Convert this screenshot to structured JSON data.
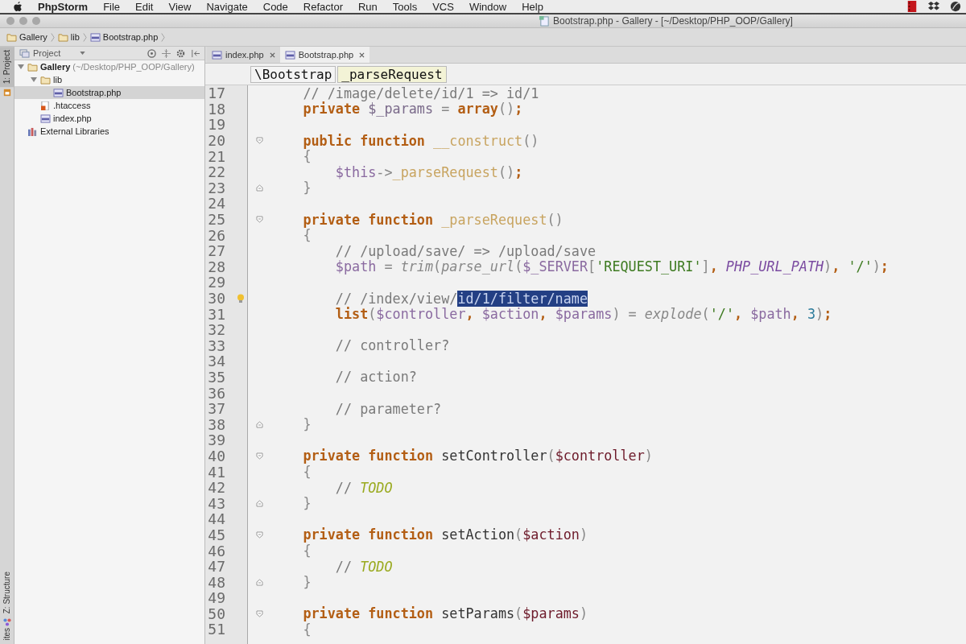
{
  "menu_bar": {
    "app": "PhpStorm",
    "items": [
      "File",
      "Edit",
      "View",
      "Navigate",
      "Code",
      "Refactor",
      "Run",
      "Tools",
      "VCS",
      "Window",
      "Help"
    ]
  },
  "window": {
    "title": "Bootstrap.php - Gallery - [~/Desktop/PHP_OOP/Gallery]"
  },
  "navigation_bar": [
    {
      "label": "Gallery",
      "kind": "folder"
    },
    {
      "label": "lib",
      "kind": "folder"
    },
    {
      "label": "Bootstrap.php",
      "kind": "php"
    }
  ],
  "tool_strip": {
    "top": "1: Project",
    "bottom": "Z: Structure",
    "cut": "ites"
  },
  "project_panel": {
    "title": "Project",
    "tree": [
      {
        "label": "Gallery",
        "hint": "(~/Desktop/PHP_OOP/Gallery)",
        "kind": "folder",
        "expanded": true,
        "selected": false,
        "children": [
          {
            "label": "lib",
            "kind": "folder",
            "expanded": true,
            "selected": false,
            "children": [
              {
                "label": "Bootstrap.php",
                "kind": "php",
                "selected": true
              }
            ]
          },
          {
            "label": ".htaccess",
            "kind": "config",
            "selected": false
          },
          {
            "label": "index.php",
            "kind": "php",
            "selected": false
          }
        ]
      },
      {
        "label": "External Libraries",
        "kind": "library",
        "selected": false
      }
    ]
  },
  "tabs": [
    {
      "label": "index.php",
      "selected": false
    },
    {
      "label": "Bootstrap.php",
      "selected": true
    }
  ],
  "editor_breadcrumb": [
    "\\Bootstrap",
    "_parseRequest"
  ],
  "lines": [
    {
      "number": "17",
      "kind": "code",
      "tokens": [
        {
          "kind": "comment",
          "text": "    // /image/delete/id/1 => id/1"
        }
      ]
    },
    {
      "number": "18",
      "kind": "code",
      "tokens": [
        {
          "kind": "kw",
          "text": "    private "
        },
        {
          "kind": "field",
          "text": "$_params"
        },
        {
          "kind": "punct",
          "text": " = "
        },
        {
          "kind": "kw",
          "text": "array"
        },
        {
          "kind": "punct",
          "text": "()"
        },
        {
          "kind": "kw",
          "text": ";"
        }
      ]
    },
    {
      "number": "19",
      "kind": "code"
    },
    {
      "number": "20",
      "kind": "fold_start",
      "tokens": [
        {
          "kind": "kw",
          "text": "    public function "
        },
        {
          "kind": "decl",
          "text": "__construct"
        },
        {
          "kind": "punct",
          "text": "()"
        }
      ]
    },
    {
      "number": "21",
      "kind": "code",
      "tokens": [
        {
          "kind": "punct",
          "text": "    {"
        }
      ]
    },
    {
      "number": "22",
      "kind": "code",
      "tokens": [
        {
          "kind": "var",
          "text": "        $this"
        },
        {
          "kind": "punct",
          "text": "->"
        },
        {
          "kind": "decl",
          "text": "_parseRequest"
        },
        {
          "kind": "punct",
          "text": "()"
        },
        {
          "kind": "kw",
          "text": ";"
        }
      ]
    },
    {
      "number": "23",
      "kind": "fold_end",
      "tokens": [
        {
          "kind": "punct",
          "text": "    }"
        }
      ]
    },
    {
      "number": "24",
      "kind": "code"
    },
    {
      "number": "25",
      "kind": "fold_start",
      "tokens": [
        {
          "kind": "kw",
          "text": "    private function "
        },
        {
          "kind": "decl",
          "text": "_parseRequest"
        },
        {
          "kind": "punct",
          "text": "()"
        }
      ]
    },
    {
      "number": "26",
      "kind": "code",
      "tokens": [
        {
          "kind": "punct",
          "text": "    {"
        }
      ]
    },
    {
      "number": "27",
      "kind": "code",
      "tokens": [
        {
          "kind": "comment",
          "text": "        // /upload/save/ => /upload/save"
        }
      ]
    },
    {
      "number": "28",
      "kind": "code",
      "tokens": [
        {
          "kind": "var",
          "text": "        $path"
        },
        {
          "kind": "punct",
          "text": " = "
        },
        {
          "kind": "call",
          "text": "trim"
        },
        {
          "kind": "punct",
          "text": "("
        },
        {
          "kind": "call",
          "text": "parse_url"
        },
        {
          "kind": "punct",
          "text": "("
        },
        {
          "kind": "var",
          "text": "$_SERVER"
        },
        {
          "kind": "punct",
          "text": "["
        },
        {
          "kind": "str",
          "text": "'REQUEST_URI'"
        },
        {
          "kind": "punct",
          "text": "]"
        },
        {
          "kind": "kw",
          "text": ", "
        },
        {
          "kind": "const",
          "text": "PHP_URL_PATH"
        },
        {
          "kind": "punct",
          "text": ")"
        },
        {
          "kind": "kw",
          "text": ", "
        },
        {
          "kind": "str",
          "text": "'/'"
        },
        {
          "kind": "punct",
          "text": ")"
        },
        {
          "kind": "kw",
          "text": ";"
        }
      ]
    },
    {
      "number": "29",
      "kind": "code"
    },
    {
      "number": "30",
      "kind": "bulb",
      "tokens": [
        {
          "kind": "comment",
          "text": "        // /index/view/"
        },
        {
          "kind": "selected",
          "text": "id/1/filter/name"
        }
      ]
    },
    {
      "number": "31",
      "kind": "code",
      "tokens": [
        {
          "kind": "kw",
          "text": "        list"
        },
        {
          "kind": "punct",
          "text": "("
        },
        {
          "kind": "var",
          "text": "$controller"
        },
        {
          "kind": "kw",
          "text": ", "
        },
        {
          "kind": "var",
          "text": "$action"
        },
        {
          "kind": "kw",
          "text": ", "
        },
        {
          "kind": "var",
          "text": "$params"
        },
        {
          "kind": "punct",
          "text": ") = "
        },
        {
          "kind": "call",
          "text": "explode"
        },
        {
          "kind": "punct",
          "text": "("
        },
        {
          "kind": "str",
          "text": "'/'"
        },
        {
          "kind": "kw",
          "text": ", "
        },
        {
          "kind": "var",
          "text": "$path"
        },
        {
          "kind": "kw",
          "text": ", "
        },
        {
          "kind": "num",
          "text": "3"
        },
        {
          "kind": "punct",
          "text": ")"
        },
        {
          "kind": "kw",
          "text": ";"
        }
      ]
    },
    {
      "number": "32",
      "kind": "code"
    },
    {
      "number": "33",
      "kind": "code",
      "tokens": [
        {
          "kind": "comment",
          "text": "        // controller?"
        }
      ]
    },
    {
      "number": "34",
      "kind": "code"
    },
    {
      "number": "35",
      "kind": "code",
      "tokens": [
        {
          "kind": "comment",
          "text": "        // action?"
        }
      ]
    },
    {
      "number": "36",
      "kind": "code"
    },
    {
      "number": "37",
      "kind": "code",
      "tokens": [
        {
          "kind": "comment",
          "text": "        // parameter?"
        }
      ]
    },
    {
      "number": "38",
      "kind": "fold_end",
      "tokens": [
        {
          "kind": "punct",
          "text": "    }"
        }
      ]
    },
    {
      "number": "39",
      "kind": "code"
    },
    {
      "number": "40",
      "kind": "fold_start",
      "tokens": [
        {
          "kind": "kw",
          "text": "    private function "
        },
        {
          "kind": "name",
          "text": "setController"
        },
        {
          "kind": "punct",
          "text": "("
        },
        {
          "kind": "param",
          "text": "$controller"
        },
        {
          "kind": "punct",
          "text": ")"
        }
      ]
    },
    {
      "number": "41",
      "kind": "code",
      "tokens": [
        {
          "kind": "punct",
          "text": "    {"
        }
      ]
    },
    {
      "number": "42",
      "kind": "code",
      "tokens": [
        {
          "kind": "comment",
          "text": "        // "
        },
        {
          "kind": "todo",
          "text": "TODO"
        }
      ]
    },
    {
      "number": "43",
      "kind": "fold_end",
      "tokens": [
        {
          "kind": "punct",
          "text": "    }"
        }
      ]
    },
    {
      "number": "44",
      "kind": "code"
    },
    {
      "number": "45",
      "kind": "fold_start",
      "tokens": [
        {
          "kind": "kw",
          "text": "    private function "
        },
        {
          "kind": "name",
          "text": "setAction"
        },
        {
          "kind": "punct",
          "text": "("
        },
        {
          "kind": "param",
          "text": "$action"
        },
        {
          "kind": "punct",
          "text": ")"
        }
      ]
    },
    {
      "number": "46",
      "kind": "code",
      "tokens": [
        {
          "kind": "punct",
          "text": "    {"
        }
      ]
    },
    {
      "number": "47",
      "kind": "code",
      "tokens": [
        {
          "kind": "comment",
          "text": "        // "
        },
        {
          "kind": "todo",
          "text": "TODO"
        }
      ]
    },
    {
      "number": "48",
      "kind": "fold_end",
      "tokens": [
        {
          "kind": "punct",
          "text": "    }"
        }
      ]
    },
    {
      "number": "49",
      "kind": "code"
    },
    {
      "number": "50",
      "kind": "fold_start",
      "tokens": [
        {
          "kind": "kw",
          "text": "    private function "
        },
        {
          "kind": "name",
          "text": "setParams"
        },
        {
          "kind": "punct",
          "text": "("
        },
        {
          "kind": "param",
          "text": "$params"
        },
        {
          "kind": "punct",
          "text": ")"
        }
      ]
    },
    {
      "number": "51",
      "kind": "code",
      "tokens": [
        {
          "kind": "punct",
          "text": "    {"
        }
      ]
    }
  ]
}
